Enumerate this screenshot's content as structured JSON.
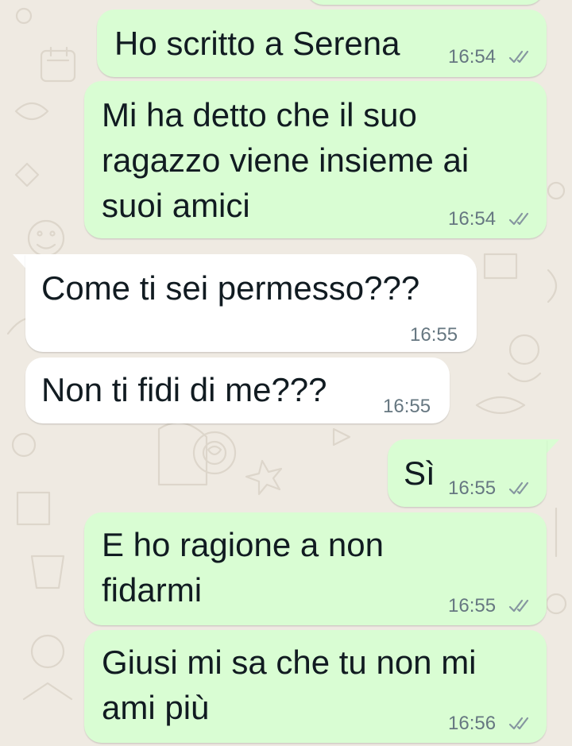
{
  "chat": {
    "messages": [
      {
        "text": "Ho scritto a Serena",
        "time": "16:54",
        "direction": "outgoing",
        "status": "read"
      },
      {
        "text_lines": [
          "Mi ha detto che il suo",
          "ragazzo viene insieme ai",
          "suoi amici"
        ],
        "time": "16:54",
        "direction": "outgoing",
        "status": "read"
      },
      {
        "text": "Come ti sei permesso???",
        "time": "16:55",
        "direction": "incoming"
      },
      {
        "text": "Non ti fidi di me???",
        "time": "16:55",
        "direction": "incoming"
      },
      {
        "text": "Sì",
        "time": "16:55",
        "direction": "outgoing",
        "status": "read"
      },
      {
        "text_lines": [
          "E ho ragione a non",
          "fidarmi"
        ],
        "time": "16:55",
        "direction": "outgoing",
        "status": "read"
      },
      {
        "text_lines": [
          "Giusi mi sa che tu non mi",
          "ami più"
        ],
        "time": "16:56",
        "direction": "outgoing",
        "status": "read"
      }
    ]
  },
  "theme": {
    "background": "#efeae2",
    "outgoing_bubble": "#d9fdd3",
    "incoming_bubble": "#ffffff",
    "text_color": "#111b21",
    "meta_color": "#667781",
    "tick_icon": "double-check-icon"
  }
}
